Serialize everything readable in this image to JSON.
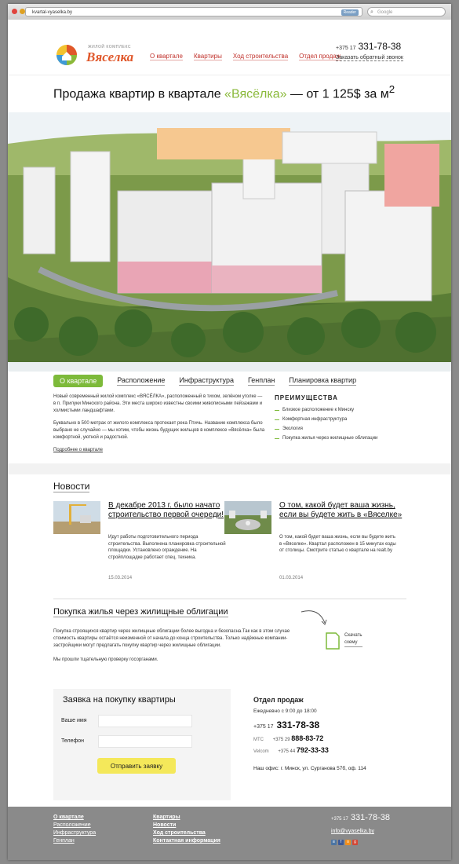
{
  "browser": {
    "url": "kvartal-vyaselka.by",
    "reader_label": "Reader",
    "search_placeholder": "Google"
  },
  "header": {
    "logo_subtitle": "ЖИЛОЙ КОМПЛЕКС",
    "logo_text": "Вяселка",
    "nav": [
      "О квартале",
      "Квартиры",
      "Ход строительства",
      "Отдел продаж"
    ],
    "phone_code": "+375 17",
    "phone": "331-78-38",
    "callback": "Заказать обратный звонок"
  },
  "hero": {
    "title_pre": "Продажа квартир в квартале ",
    "title_name": "«Вясёлка»",
    "title_post": " — от 1 125$ за м",
    "title_sup": "2"
  },
  "tabs": [
    "О квартале",
    "Расположение",
    "Инфраструктура",
    "Генплан",
    "Планировка квартир"
  ],
  "about": {
    "p1": "Новый современный жилой комплекс «ВЯСЁЛКА», расположенный в тихом, зелёном уголке — в п. Прилуки Минского района. Эти места широко известны своими живописными пейзажами и холмистыми ландшафтами.",
    "p2": "Буквально в 500 метрах от жилого комплекса протекает река Птичь. Название комплекса было выбрано не случайно — мы хотим, чтобы жизнь будущих жильцов в комплексе «Вясёлка» была комфортной, уютной и радостной.",
    "more": "Подробнее о квартале"
  },
  "advantages": {
    "title": "ПРЕИМУЩЕСТВА",
    "items": [
      "Близкое расположение к Минску",
      "Комфортная инфраструктура",
      "Экология",
      "Покупка жилья через жилищные облигации"
    ]
  },
  "news": {
    "title": "Новости",
    "items": [
      {
        "headline": "В декабре 2013 г. было начато строительство первой очереди!",
        "text": "Идут работы подготовительного периода строительства. Выполнена планировка строительной площадки. Установлено ограждение. На стройплощадке работает спец. техника.",
        "date": "15.03.2014"
      },
      {
        "headline": "О том, какой будет ваша жизнь, если вы будете жить в «Вяселке»",
        "text": "О том, какой будет ваша жизнь, если вы будете жить в «Вяселке». Квартал расположен в 15 минутах езды от столицы. Смотрите статью о квартале на realt.by",
        "date": "01.03.2014"
      }
    ]
  },
  "bonds": {
    "title": "Покупка жилья через жилищные облигации",
    "p1": "Покупка строящихся квартир через жилищные облигации более выгодна и безопасна.Так как в этом случае стоимость квартиры остаётся неизменной от начала до конца строительства. Только надёжные компании-застройщики могут предлагать покупку квартир через жилищные облигации.",
    "p2": "Мы прошли тщательную проверку госорганами.",
    "scheme_label_1": "Скачать",
    "scheme_label_2": "схему"
  },
  "order_form": {
    "title": "Заявка на покупку квартиры",
    "name_label": "Ваше имя",
    "phone_label": "Телефон",
    "submit": "Отправить заявку"
  },
  "sales": {
    "title": "Отдел продаж",
    "hours": "Ежедневно с 9:00 до 18:00",
    "main_code": "+375 17",
    "main_phone": "331-78-38",
    "mts_label": "МТС",
    "mts_code": "+375 29",
    "mts_phone": "888-83-72",
    "velcom_label": "Velcom",
    "velcom_code": "+375 44",
    "velcom_phone": "792-33-33",
    "address": "Наш офис: г. Минск, ул. Сурганова 57б, оф. 114"
  },
  "footer": {
    "col1": [
      "О квартале",
      "Расположение",
      "Инфраструктура",
      "Генплан"
    ],
    "col2": [
      "Квартиры",
      "Новости",
      "Ход строительства",
      "Контактная информация"
    ],
    "phone_code": "+375 17",
    "phone": "331-78-38",
    "email": "info@vyaselka.by",
    "social": [
      "vk-icon",
      "facebook-icon",
      "odnoklassniki-icon",
      "google-plus-icon"
    ]
  }
}
